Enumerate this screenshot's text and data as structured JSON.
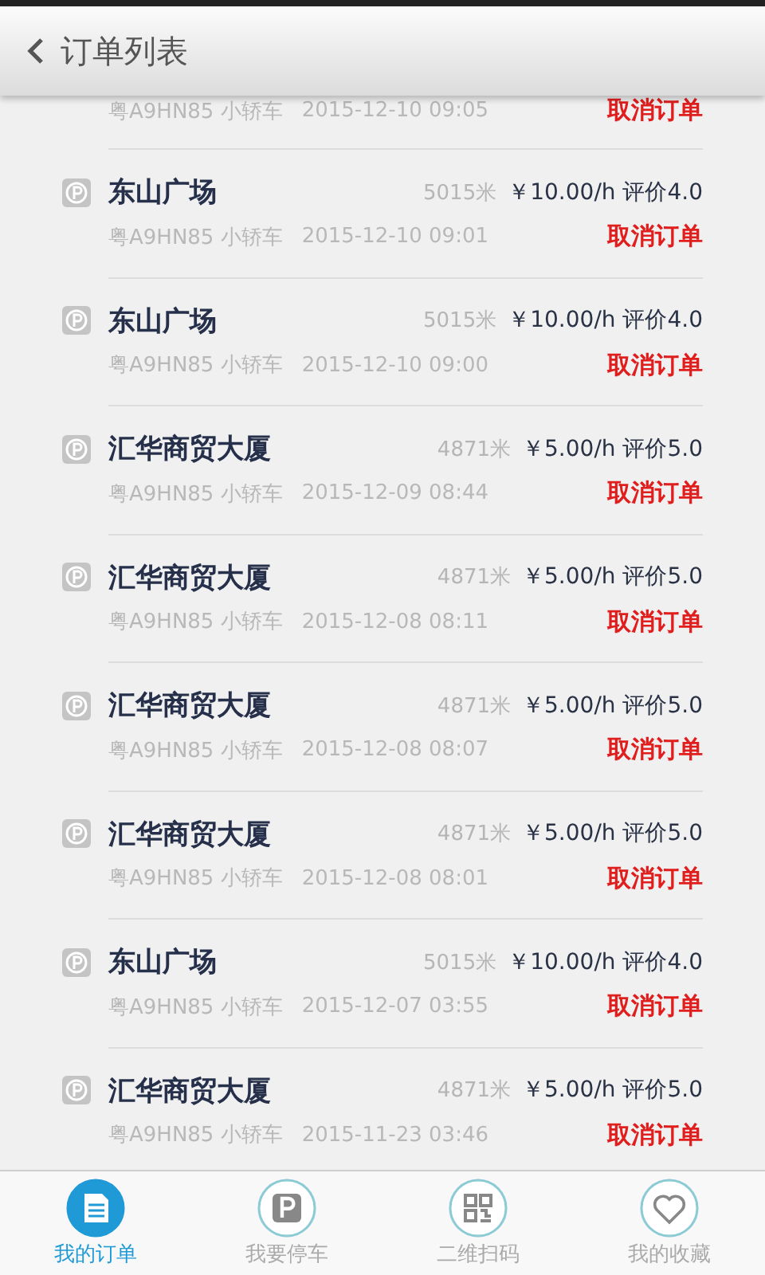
{
  "header": {
    "title": "订单列表"
  },
  "orders": [
    {
      "plate": "粤A9HN85 小轿车",
      "time": "2015-12-10 09:05",
      "action": "取消订单"
    },
    {
      "name": "东山广场",
      "distance": "5015米",
      "price": "￥10.00/h 评价4.0",
      "plate": "粤A9HN85 小轿车",
      "time": "2015-12-10 09:01",
      "action": "取消订单"
    },
    {
      "name": "东山广场",
      "distance": "5015米",
      "price": "￥10.00/h 评价4.0",
      "plate": "粤A9HN85 小轿车",
      "time": "2015-12-10 09:00",
      "action": "取消订单"
    },
    {
      "name": "汇华商贸大厦",
      "distance": "4871米",
      "price": "￥5.00/h 评价5.0",
      "plate": "粤A9HN85 小轿车",
      "time": "2015-12-09 08:44",
      "action": "取消订单"
    },
    {
      "name": "汇华商贸大厦",
      "distance": "4871米",
      "price": "￥5.00/h 评价5.0",
      "plate": "粤A9HN85 小轿车",
      "time": "2015-12-08 08:11",
      "action": "取消订单"
    },
    {
      "name": "汇华商贸大厦",
      "distance": "4871米",
      "price": "￥5.00/h 评价5.0",
      "plate": "粤A9HN85 小轿车",
      "time": "2015-12-08 08:07",
      "action": "取消订单"
    },
    {
      "name": "汇华商贸大厦",
      "distance": "4871米",
      "price": "￥5.00/h 评价5.0",
      "plate": "粤A9HN85 小轿车",
      "time": "2015-12-08 08:01",
      "action": "取消订单"
    },
    {
      "name": "东山广场",
      "distance": "5015米",
      "price": "￥10.00/h 评价4.0",
      "plate": "粤A9HN85 小轿车",
      "time": "2015-12-07 03:55",
      "action": "取消订单"
    },
    {
      "name": "汇华商贸大厦",
      "distance": "4871米",
      "price": "￥5.00/h 评价5.0",
      "plate": "粤A9HN85 小轿车",
      "time": "2015-11-23 03:46",
      "action": "取消订单"
    }
  ],
  "tabs": [
    {
      "kind": "orders",
      "label": "我的订单",
      "selected": true
    },
    {
      "kind": "parking",
      "label": "我要停车",
      "selected": false
    },
    {
      "kind": "qr",
      "label": "二维扫码",
      "selected": false
    },
    {
      "kind": "favorites",
      "label": "我的收藏",
      "selected": false
    }
  ]
}
